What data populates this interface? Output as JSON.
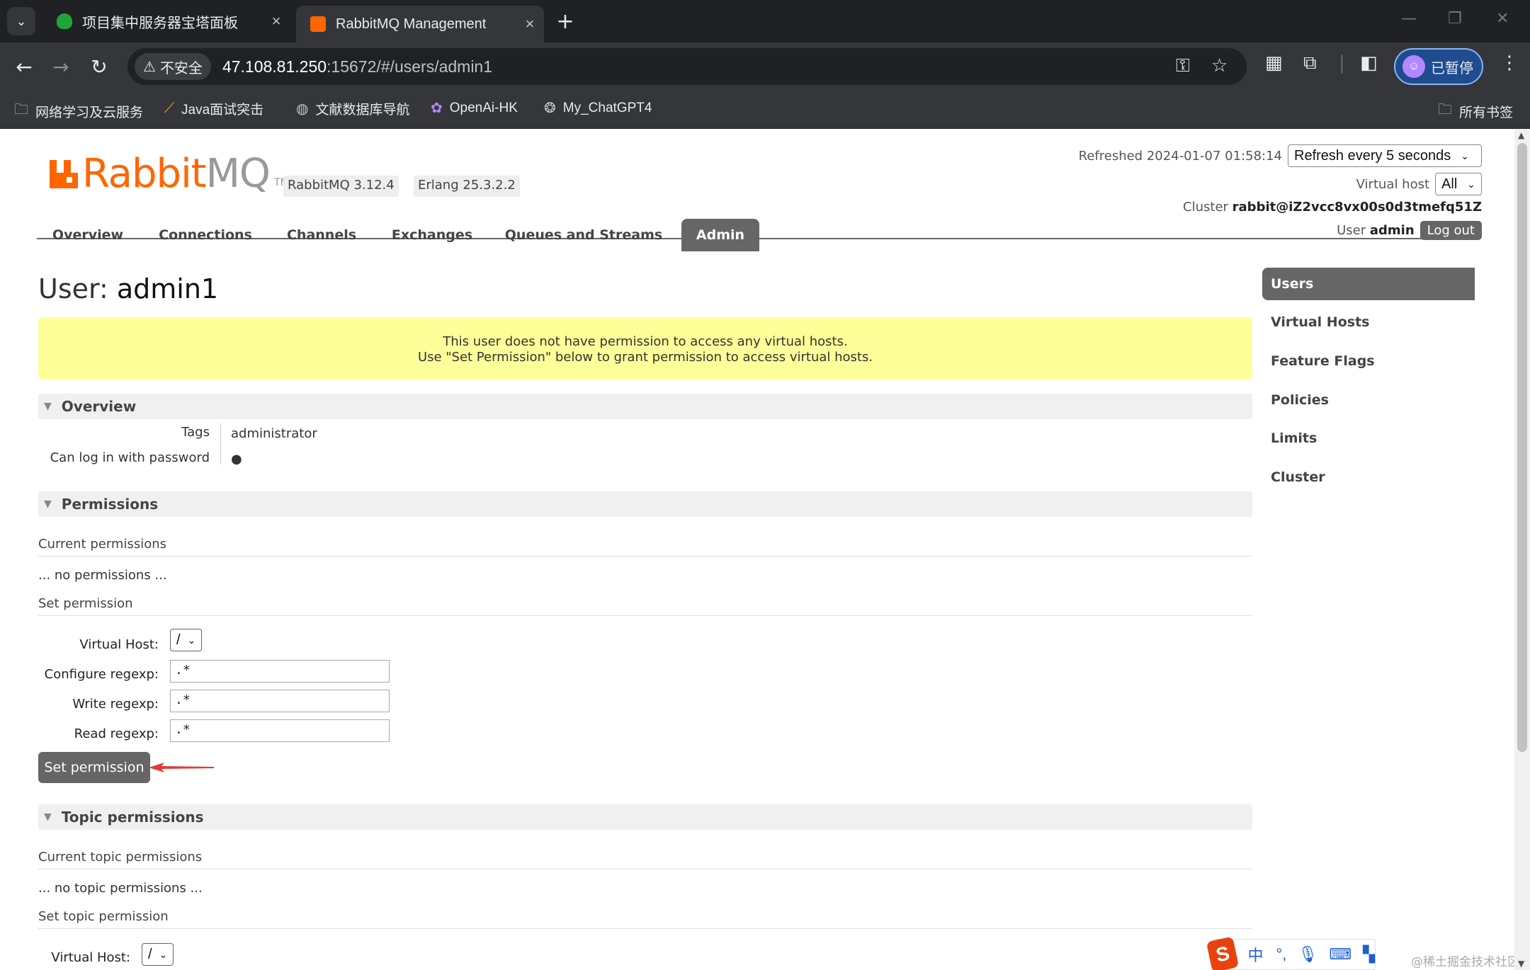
{
  "browser": {
    "tabs": [
      {
        "title": "项目集中服务器宝塔面板",
        "active": false
      },
      {
        "title": "RabbitMQ Management",
        "active": true
      }
    ],
    "security_label": "不安全",
    "url_host": "47.108.81.250",
    "url_rest": ":15672/#/users/admin1",
    "profile_label": "已暂停",
    "bookmarks": [
      "网络学习及云服务",
      "Java面试突击",
      "文献数据库导航",
      "OpenAi-HK",
      "My_ChatGPT4"
    ],
    "all_bookmarks": "所有书签"
  },
  "header": {
    "logo_rabbit": "Rabbit",
    "logo_mq": "MQ",
    "logo_tm": "TM",
    "rabbitmq_version": "RabbitMQ 3.12.4",
    "erlang_version": "Erlang 25.3.2.2",
    "refreshed_label": "Refreshed 2024-01-07 01:58:14",
    "refresh_select": "Refresh every 5 seconds",
    "vhost_label": "Virtual host",
    "vhost_select": "All",
    "cluster_label": "Cluster",
    "cluster_name": "rabbit@iZ2vcc8vx00s0d3tmefq51Z",
    "user_label": "User",
    "user_name": "admin",
    "logout": "Log out"
  },
  "nav": {
    "tabs": [
      "Overview",
      "Connections",
      "Channels",
      "Exchanges",
      "Queues and Streams",
      "Admin"
    ],
    "active": "Admin"
  },
  "page": {
    "title_prefix": "User:",
    "title_name": "admin1",
    "warning_line1": "This user does not have permission to access any virtual hosts.",
    "warning_line2": "Use \"Set Permission\" below to grant permission to access virtual hosts."
  },
  "overview": {
    "heading": "Overview",
    "tags_label": "Tags",
    "tags_value": "administrator",
    "login_label": "Can log in with password",
    "login_value": "●"
  },
  "permissions": {
    "heading": "Permissions",
    "current_label": "Current permissions",
    "none_text": "... no permissions ...",
    "set_label": "Set permission",
    "vhost_label": "Virtual Host:",
    "vhost_value": "/",
    "configure_label": "Configure regexp:",
    "configure_value": ".*",
    "write_label": "Write regexp:",
    "write_value": ".*",
    "read_label": "Read regexp:",
    "read_value": ".*",
    "button": "Set permission"
  },
  "topic_permissions": {
    "heading": "Topic permissions",
    "current_label": "Current topic permissions",
    "none_text": "... no topic permissions ...",
    "set_label": "Set topic permission",
    "vhost_label": "Virtual Host:",
    "vhost_value": "/"
  },
  "sidebar": {
    "items": [
      "Users",
      "Virtual Hosts",
      "Feature Flags",
      "Policies",
      "Limits",
      "Cluster"
    ],
    "active": "Users"
  },
  "ime": {
    "logo": "S",
    "mode": "中"
  },
  "watermark": "@稀土掘金技术社区",
  "colors": {
    "rabbit_orange": "#ff6600",
    "tab_grey": "#666666",
    "warning_yellow": "#ffff99",
    "arrow_red": "#e53935"
  }
}
